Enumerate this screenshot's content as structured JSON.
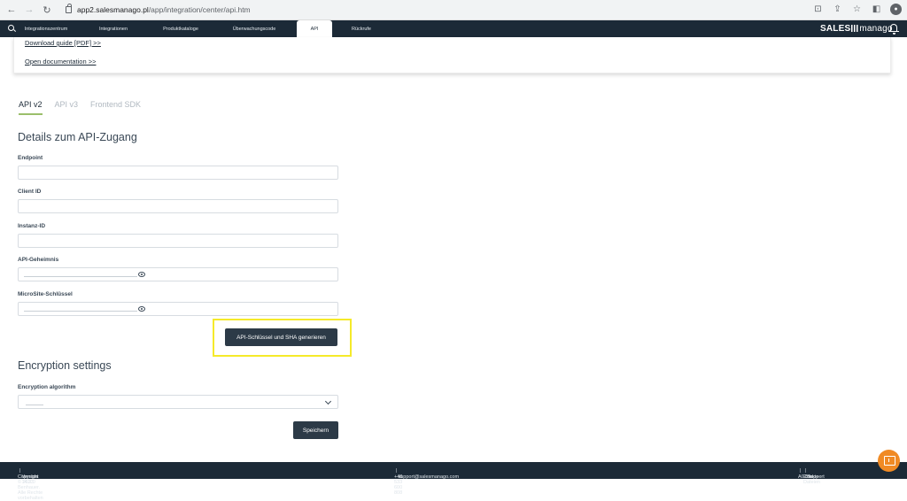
{
  "browser": {
    "back_icon": "arrow-left-icon",
    "url_host": "app2.salesmanago.pl",
    "url_path": "/app/integration/center/api.htm"
  },
  "appnav": {
    "tabs": [
      {
        "label": "Integrationszentrum"
      },
      {
        "label": "Integrationen"
      },
      {
        "label": "Produktkataloge"
      },
      {
        "label": "Überwachungscode"
      },
      {
        "label": "API"
      },
      {
        "label": "Rückrufe"
      }
    ],
    "active_tab": "API",
    "brand_left": "SALES",
    "brand_right": "manago"
  },
  "docs": {
    "download_guide": "Download guide [PDF] >>",
    "open_documentation": "Open documentation >>"
  },
  "api_tabs": [
    {
      "label": "API v2"
    },
    {
      "label": "API v3"
    },
    {
      "label": "Frontend SDK"
    }
  ],
  "details": {
    "title": "Details zum API-Zugang",
    "endpoint_label": "Endpoint",
    "client_id_label": "Client ID",
    "instance_id_label": "Instanz-ID",
    "api_secret_label": "API-Geheimnis",
    "microsite_key_label": "MicroSite-Schlüssel",
    "generate_button": "API-Schlüssel und SHA generieren"
  },
  "encryption": {
    "title": "Encryption settings",
    "algorithm_label": "Encryption algorithm",
    "save_button": "Speichern"
  },
  "footer": {
    "copyright": "Copyright © 2023 Benhauer. Alle Rechte vorbehalten",
    "version": "Version 14.3.0",
    "phone": "+48 533 600 808",
    "email": "support@salesmanago.com",
    "agbs": "AGBhs",
    "cookies": "Cookie-Dateien",
    "support": "Support"
  },
  "colors": {
    "nav_bg": "#1c2a37",
    "accent_green": "#9bbf6b",
    "highlight_yellow": "#f5ea2a",
    "chat_orange": "#f08a24"
  }
}
